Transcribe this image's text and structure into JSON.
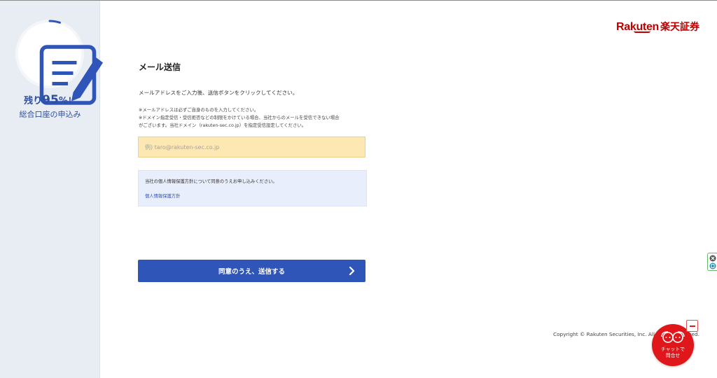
{
  "sidebar": {
    "progress_percent": 5,
    "remain_prefix": "残り",
    "remain_value": "95",
    "remain_suffix": "%",
    "remain_excl": "！",
    "subtitle": "総合口座の申込み"
  },
  "logo": {
    "brand": "Rakuten",
    "jp": "楽天証券"
  },
  "main": {
    "title": "メール送信",
    "instruction": "メールアドレスをご入力後、送信ボタンをクリックしてください。",
    "notes": [
      "※メールアドレスは必ずご自身のものを入力してください。",
      "※ドメイン指定受信・受信拒否などの制限をかけている場合、当社からのメールを受信できない場合",
      "がございます。当社ドメイン（rakuten-sec.co.jp）を指定受信設定してください。"
    ],
    "email_placeholder": "例) taro@rakuten-sec.co.jp",
    "email_value": "",
    "privacy_text": "当社の個人情報保護方針について同意のうえお申し込みください。",
    "privacy_link": "個人情報保護方針",
    "submit_label": "同意のうえ、送信する"
  },
  "footer": {
    "copyright": "Copyright © Rakuten Securities, Inc. All Rights Reserved."
  },
  "chat": {
    "label_line1": "チャットで",
    "label_line2": "問合せ"
  },
  "colors": {
    "accent_blue": "#2f55b8",
    "brand_red": "#bf0000",
    "chat_red": "#e0161b",
    "input_bg": "#fde7b3",
    "sidebar_bg": "#e8edf4"
  }
}
